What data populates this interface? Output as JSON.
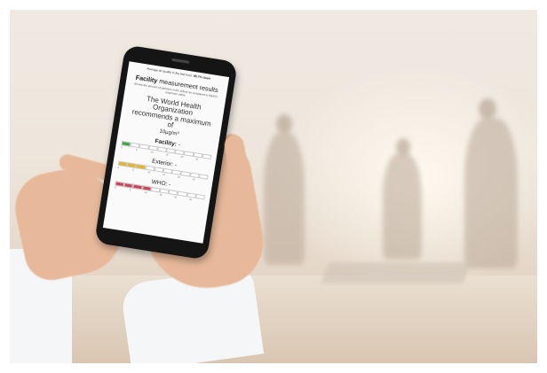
{
  "scene": {
    "description_tags": [
      "office-background",
      "hands-holding-smartphone"
    ]
  },
  "phone_screen": {
    "top_line": "Average air quality in the last hour:",
    "top_value": "98.7% clean",
    "heading_bold": "Facility",
    "heading_rest": "measurement results",
    "subtitle": "Shows the amount of particles in the indoor air compared to WHO's maximum value",
    "who_text": "The World Health Organization recommends a maximum of",
    "unit_text": "10µg/m³",
    "facility_label": "Facility:",
    "facility_value": "-",
    "exterior_label": "Exterior:",
    "exterior_value": "-",
    "who_label": "WHO:",
    "who_value": "-",
    "tick_labels": [
      "0",
      "5",
      "10",
      "15",
      "20",
      "25"
    ],
    "facility_fill": 0.1,
    "exterior_fill": 0.35,
    "who_fill": 0.4,
    "colors": {
      "facility": "#3aa845",
      "exterior": "#e6b422",
      "who": "#d0415a"
    }
  }
}
